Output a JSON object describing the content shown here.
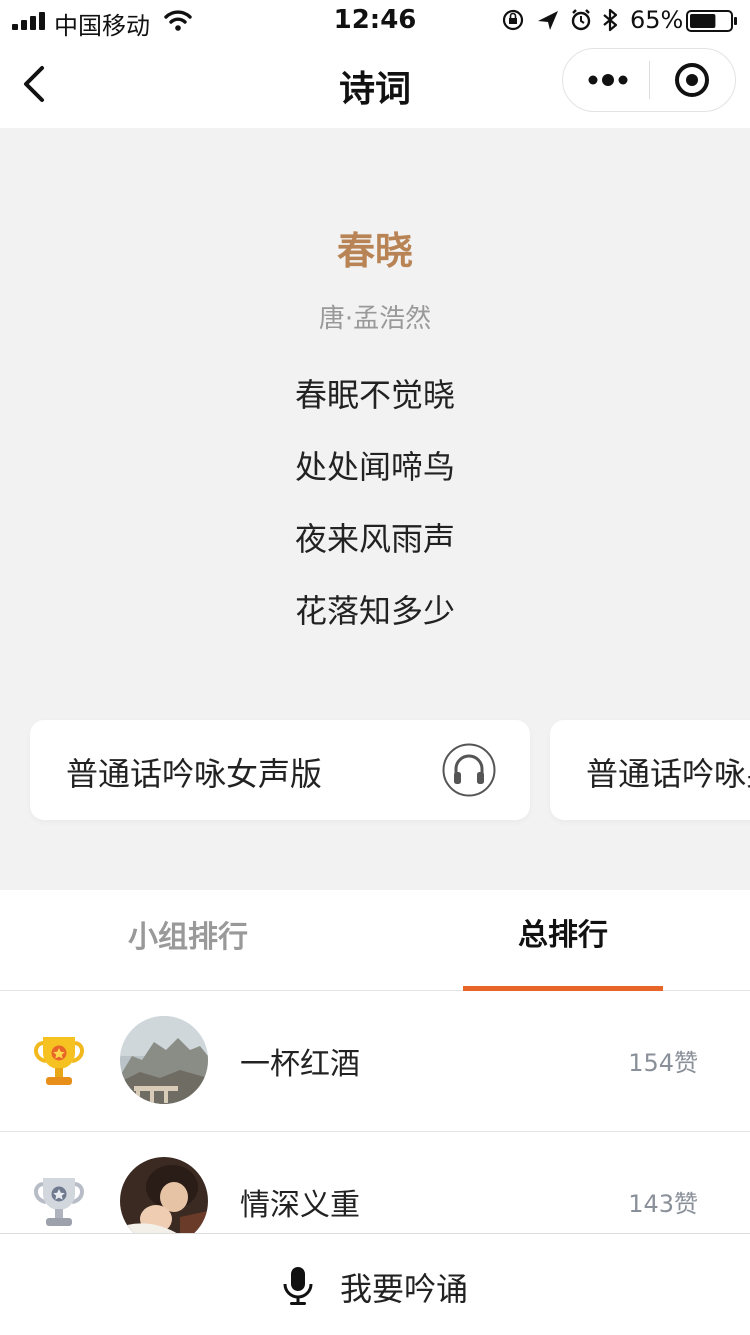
{
  "status_bar": {
    "carrier": "中国移动",
    "time": "12:46",
    "battery_percent": "65%",
    "battery_level": 0.65,
    "icons": [
      "signal-icon",
      "wifi-icon",
      "lock-rotation-icon",
      "location-icon",
      "alarm-icon",
      "bluetooth-icon",
      "battery-icon"
    ]
  },
  "nav": {
    "title": "诗词",
    "icons": [
      "back-icon",
      "more-icon",
      "target-icon"
    ]
  },
  "poem": {
    "title": "春晓",
    "author": "唐·孟浩然",
    "lines": [
      "春眠不觉晓",
      "处处闻啼鸟",
      "夜来风雨声",
      "花落知多少"
    ]
  },
  "audio_cards": [
    {
      "label": "普通话吟咏女声版",
      "icon": "headphones-icon"
    },
    {
      "label": "普通话吟咏男声版",
      "icon": "headphones-icon"
    }
  ],
  "tabs": {
    "group": "小组排行",
    "total": "总排行",
    "active": "total"
  },
  "ranking": [
    {
      "name": "一杯红酒",
      "likes": "154赞",
      "trophy": "gold-trophy-icon"
    },
    {
      "name": "情深义重",
      "likes": "143赞",
      "trophy": "silver-trophy-icon"
    }
  ],
  "bottom": {
    "label": "我要吟诵",
    "icon": "microphone-icon"
  },
  "colors": {
    "accent": "#e8652a",
    "poem_title": "#b98455",
    "background": "#f2f2f2"
  }
}
